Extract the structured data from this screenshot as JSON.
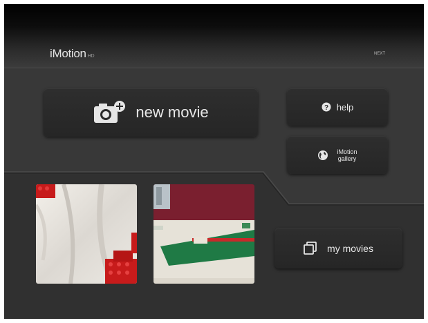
{
  "app": {
    "title": "iMotion",
    "title_suffix": "HD",
    "top_right_label": "NEXT"
  },
  "buttons": {
    "new_movie": "new movie",
    "help": "help",
    "gallery_line1": "iMotion",
    "gallery_line2": "gallery",
    "my_movies": "my movies"
  },
  "icons": {
    "new_movie": "camera-plus-icon",
    "help": "question-icon",
    "gallery": "globe-icon",
    "my_movies": "stacked-photos-icon"
  },
  "thumbnails": [
    {
      "name": "movie-thumbnail-1",
      "description_colors": [
        "#eae6e0",
        "#c51a1a"
      ]
    },
    {
      "name": "movie-thumbnail-2",
      "description_colors": [
        "#7a1d2e",
        "#1e7a45"
      ]
    }
  ],
  "colors": {
    "background": "#3a3a3a",
    "button": "#2a2a2a",
    "text": "#e8e8e8"
  }
}
